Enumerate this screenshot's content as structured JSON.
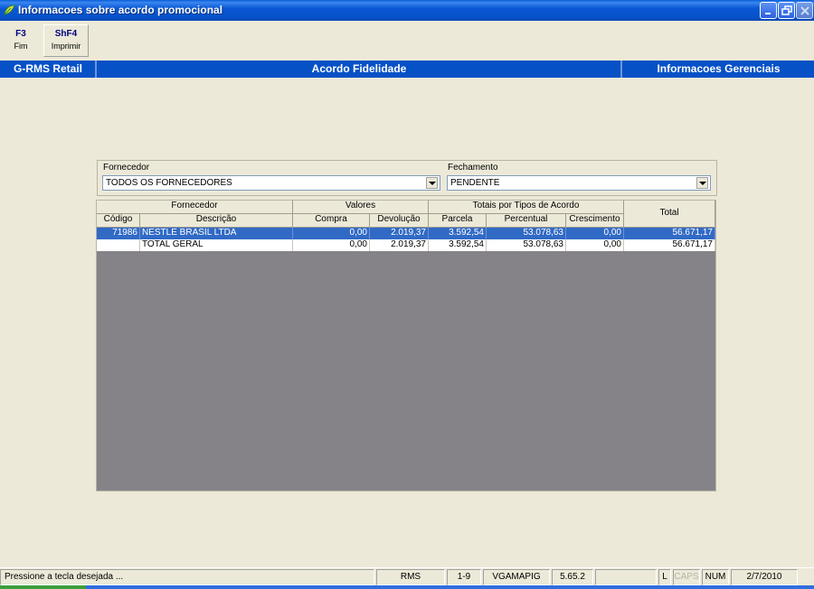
{
  "window": {
    "title": "Informacoes sobre acordo promocional",
    "icon": "app-leaf-icon"
  },
  "toolbar": {
    "buttons": [
      {
        "key": "F3",
        "label": "Fim"
      },
      {
        "key": "ShF4",
        "label": "Imprimir"
      }
    ]
  },
  "header": {
    "left": "G-RMS Retail",
    "center": "Acordo Fidelidade",
    "right": "Informacoes Gerenciais"
  },
  "filters": {
    "fornecedor_label": "Fornecedor",
    "fornecedor_value": "TODOS OS FORNECEDORES",
    "fechamento_label": "Fechamento",
    "fechamento_value": "PENDENTE"
  },
  "grid": {
    "group_headers": {
      "fornecedor": "Fornecedor",
      "valores": "Valores",
      "totais": "Totais por Tipos de Acordo",
      "total": "Total"
    },
    "columns": [
      "Código",
      "Descrição",
      "Compra",
      "Devolução",
      "Parcela",
      "Percentual",
      "Crescimento"
    ],
    "rows": [
      {
        "codigo": "71986",
        "descricao": "NESTLE BRASIL LTDA",
        "compra": "0,00",
        "devolucao": "2.019,37",
        "parcela": "3.592,54",
        "percentual": "53.078,63",
        "crescimento": "0,00",
        "total": "56.671,17"
      },
      {
        "codigo": "",
        "descricao": "TOTAL GERAL",
        "compra": "0,00",
        "devolucao": "2.019,37",
        "parcela": "3.592,54",
        "percentual": "53.078,63",
        "crescimento": "0,00",
        "total": "56.671,17"
      }
    ]
  },
  "status": {
    "message": "Pressione a tecla desejada ...",
    "system": "RMS",
    "range": "1-9",
    "user": "VGAMAPIG",
    "version": "5.65.2",
    "blank": "",
    "l": "L",
    "caps": "CAPS",
    "num": "NUM",
    "date": "2/7/2010"
  },
  "colors": {
    "title_bar": "#0a58d4",
    "header_band": "#0651c6",
    "selected_row": "#316ac5",
    "grid_bg": "#858388"
  }
}
